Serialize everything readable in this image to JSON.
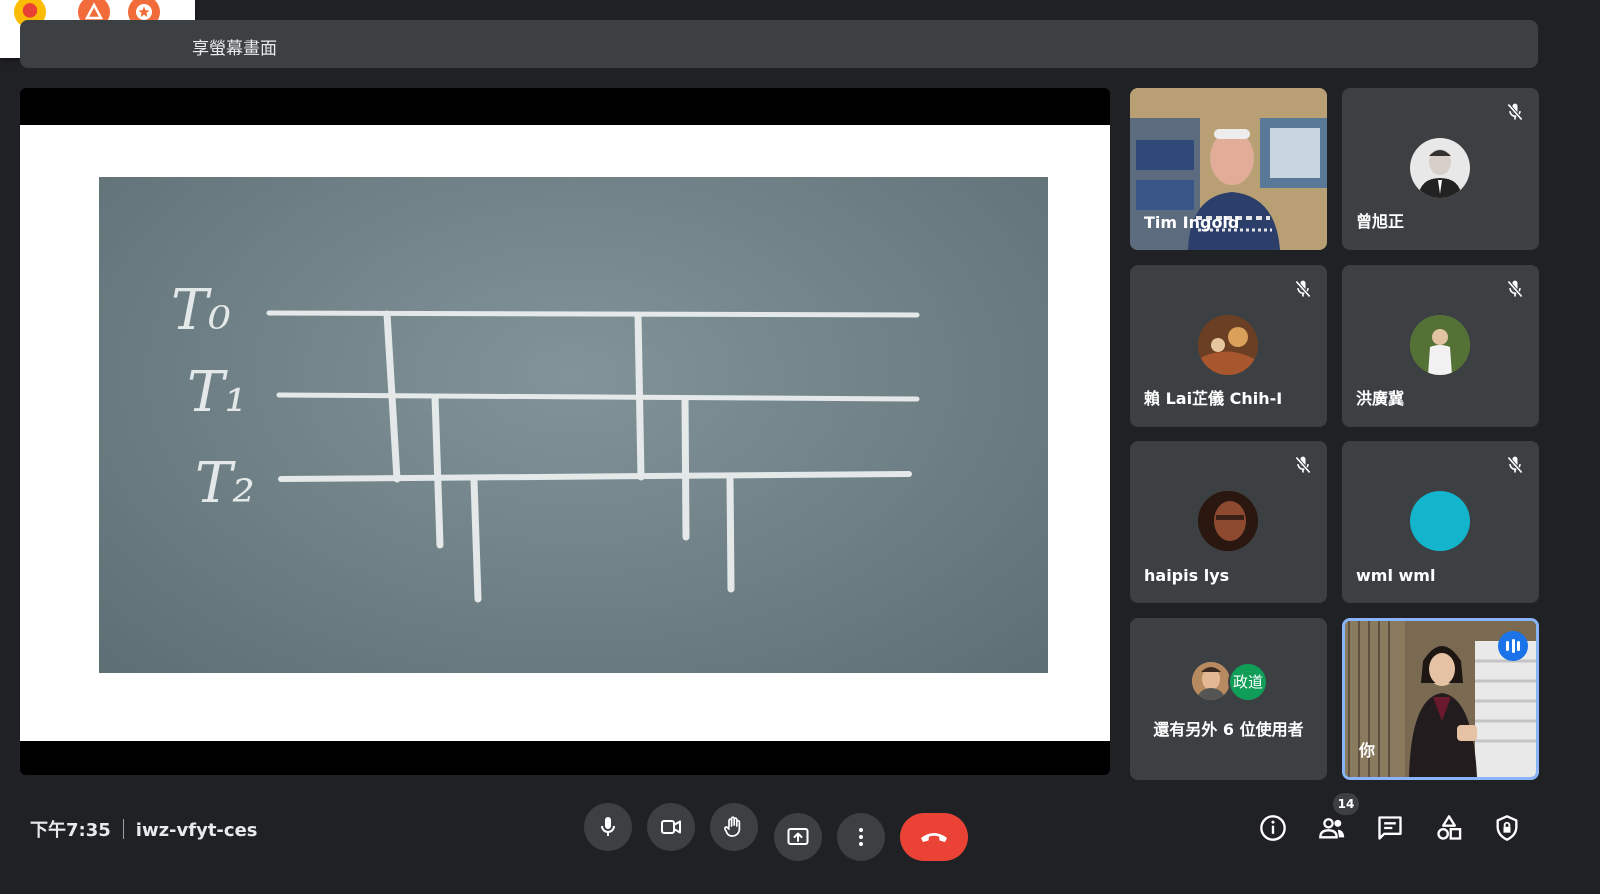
{
  "screen_share_banner": {
    "text": "享螢幕畫面"
  },
  "slide": {
    "labels": [
      "T₀",
      "T₁",
      "T₂"
    ]
  },
  "participants": [
    {
      "name": "Tim Ingold",
      "muted": false,
      "video": true
    },
    {
      "name": "曾旭正",
      "muted": true,
      "video": false
    },
    {
      "name": "賴 Lai芷儀 Chih-I",
      "muted": true,
      "video": false
    },
    {
      "name": "洪廣冀",
      "muted": true,
      "video": false
    },
    {
      "name": "haipis lys",
      "muted": true,
      "video": false
    },
    {
      "name": "wml wml",
      "muted": true,
      "video": false,
      "avatar_color": "#12b5cb"
    }
  ],
  "others_tile": {
    "text": "還有另外 6 位使用者",
    "chip_label": "政道",
    "chip_color": "#0f9d58"
  },
  "self_tile": {
    "name": "你",
    "speaking": true
  },
  "meeting": {
    "time": "下午7:35",
    "code": "iwz-vfyt-ces"
  },
  "people_count": "14",
  "colors": {
    "accent": "#1a73e8",
    "end_call": "#ea4335",
    "surface": "#3c4043",
    "background": "#202124"
  },
  "icons": [
    "mic-icon",
    "camera-icon",
    "raise-hand-icon",
    "present-screen-icon",
    "more-options-icon",
    "end-call-icon",
    "info-icon",
    "people-icon",
    "chat-icon",
    "activities-icon",
    "host-controls-icon",
    "mic-off-icon"
  ]
}
